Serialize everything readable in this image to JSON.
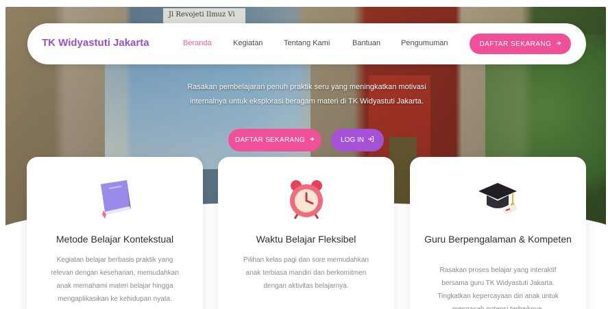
{
  "hero": {
    "board_text": "Jl Revojeti Ilmuz Vi",
    "description": "Rasakan pembelajaran penuh praktik seru yang meningkatkan motivasi internalnya untuk eksplorasi beragam materi di TK Widyastuti Jakarta.",
    "primary_label": "DAFTAR SEKARANG",
    "secondary_label": "LOG IN"
  },
  "navbar": {
    "brand": "TK Widyastuti Jakarta",
    "items": [
      {
        "label": "Beranda",
        "active": true
      },
      {
        "label": "Kegiatan",
        "active": false
      },
      {
        "label": "Tentang Kami",
        "active": false
      },
      {
        "label": "Bantuan",
        "active": false
      },
      {
        "label": "Pengumuman",
        "active": false
      }
    ],
    "cta_label": "DAFTAR SEKARANG"
  },
  "cards": [
    {
      "icon": "book-icon",
      "title": "Metode Belajar Kontekstual",
      "description": "Kegiatan belajar berbasis praktik yang relevan dengan keseharian, memudahkan anak memahami materi belajar hingga mengaplikasikan ke kehidupan nyata."
    },
    {
      "icon": "alarm-clock-icon",
      "title": "Waktu Belajar Fleksibel",
      "description": "Pilihan kelas pagi dan sore memudahkan anak terbiasa mandiri dan berkomitmen dengan aktivitas belajarnya."
    },
    {
      "icon": "graduation-cap-icon",
      "title": "Guru Berpengalaman & Kompeten",
      "description": "Rasakan proses belajar yang interaktif bersama guru TK Widyastuti Jakarta. Tingkatkan kepercayaan diri anak untuk mengasah potensi terbaiknya."
    }
  ],
  "colors": {
    "brand": "#9a4fc7",
    "accent_pink": "#f0509a",
    "accent_purple": "#a552d8"
  }
}
